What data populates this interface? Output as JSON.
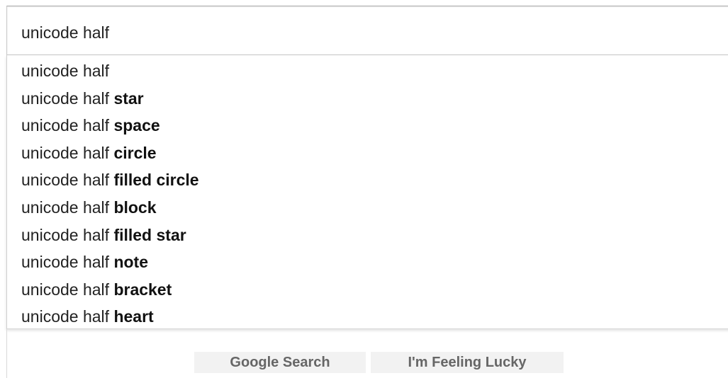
{
  "search": {
    "query": "unicode half",
    "placeholder": ""
  },
  "suggestions": [
    {
      "typed": "unicode half",
      "completion": ""
    },
    {
      "typed": "unicode half ",
      "completion": "star"
    },
    {
      "typed": "unicode half ",
      "completion": "space"
    },
    {
      "typed": "unicode half ",
      "completion": "circle"
    },
    {
      "typed": "unicode half ",
      "completion": "filled circle"
    },
    {
      "typed": "unicode half ",
      "completion": "block"
    },
    {
      "typed": "unicode half ",
      "completion": "filled star"
    },
    {
      "typed": "unicode half ",
      "completion": "note"
    },
    {
      "typed": "unicode half ",
      "completion": "bracket"
    },
    {
      "typed": "unicode half ",
      "completion": "heart"
    }
  ],
  "buttons": {
    "search_label": "Google Search",
    "lucky_label": "I'm Feeling Lucky"
  },
  "colors": {
    "text": "#222222",
    "button_bg": "#f2f2f2",
    "button_text": "#666666",
    "border": "#c9c9c9"
  }
}
